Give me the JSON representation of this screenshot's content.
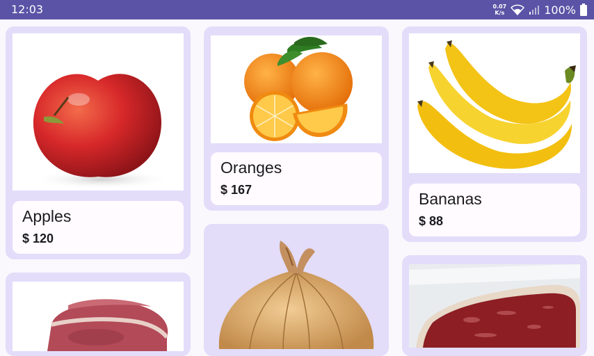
{
  "status_bar": {
    "time": "12:03",
    "net_speed_value": "0.07",
    "net_speed_unit": "K/s",
    "battery": "100%",
    "icons": [
      "wifi-icon",
      "signal-icon",
      "battery-icon"
    ]
  },
  "products": [
    {
      "name": "Apples",
      "price": "$ 120",
      "image": "apple-image"
    },
    {
      "name": "Oranges",
      "price": "$ 167",
      "image": "oranges-image"
    },
    {
      "name": "Bananas",
      "price": "$ 88",
      "image": "bananas-image"
    },
    {
      "name": "",
      "price": "",
      "image": "pork-image"
    },
    {
      "name": "",
      "price": "",
      "image": "onion-image"
    },
    {
      "name": "",
      "price": "",
      "image": "beef-image"
    }
  ],
  "colors": {
    "status_bar": "#5a53a6",
    "card_background": "#e3ddfa",
    "info_background": "#fffbff",
    "page_background": "#fbf8fd"
  }
}
